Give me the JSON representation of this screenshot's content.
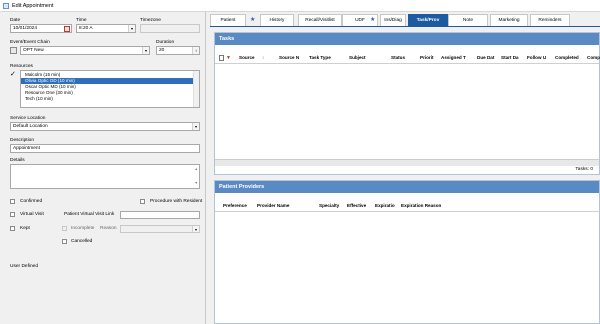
{
  "window": {
    "title": "Edit Appointment"
  },
  "form": {
    "date_label": "Date",
    "date_value": "10/01/2024",
    "time_label": "Time",
    "time_value": "8:20 A",
    "timezone_label": "Timezone",
    "timezone_value": "",
    "event_chain_label": "Event/Event Chain",
    "event_chain_value": "OPT New",
    "duration_label": "Duration",
    "duration_value": "20",
    "resources_label": "Resources",
    "resources": [
      {
        "label": "Malcolm (15 min)",
        "selected": false
      },
      {
        "label": "Olivia Optic OD (10 min)",
        "selected": true
      },
      {
        "label": "Oscar Optic MD (10 min)",
        "selected": false
      },
      {
        "label": "Resource One (30 min)",
        "selected": false
      },
      {
        "label": "Tech (10 min)",
        "selected": false
      }
    ],
    "service_location_label": "Service Location",
    "service_location_value": "Default Location",
    "description_label": "Description",
    "description_value": "Appointment",
    "details_label": "Details",
    "details_value": "",
    "confirmed_label": "Confirmed",
    "procedure_label": "Procedure with Resident",
    "virtual_visit_label": "Virtual Visit",
    "virtual_link_label": "Patient Virtual Visit Link",
    "virtual_link_value": "",
    "kept_label": "Kept",
    "incomplete_label": "Incomplete",
    "reason_label": "Reason",
    "reason_value": "",
    "cancelled_label": "Cancelled",
    "user_defined_label": "User Defined"
  },
  "tabs": [
    {
      "label": "Patient",
      "active": false,
      "pinned": false
    },
    {
      "label": "History",
      "active": false,
      "pinned": true
    },
    {
      "label": "Recall/Visitlist",
      "active": false,
      "pinned": false
    },
    {
      "label": "UDF",
      "active": false,
      "pinned": false
    },
    {
      "label": "Ins/Diag",
      "active": false,
      "pinned": true
    },
    {
      "label": "Task/Prov",
      "active": true,
      "pinned": false
    },
    {
      "label": "Note",
      "active": false,
      "pinned": false
    },
    {
      "label": "Marketing",
      "active": false,
      "pinned": false
    },
    {
      "label": "Reminders",
      "active": false,
      "pinned": false
    }
  ],
  "tasks": {
    "title": "Tasks",
    "columns": [
      "Source",
      "Source N",
      "Task Type",
      "Subject",
      "Status",
      "Priorit",
      "Assigned T",
      "Due Dat",
      "Start Da",
      "Follow U",
      "Completed",
      "Comp"
    ],
    "rows": [],
    "count_text": "Tasks: 0"
  },
  "providers": {
    "title": "Patient Providers",
    "columns": [
      "Preference",
      "Provider Name",
      "Specialty",
      "Effective",
      "Expiratio",
      "Expiration Reason"
    ],
    "rows": []
  },
  "colors": {
    "accent": "#1e5aa0",
    "panel_header": "#5a8ac4",
    "selection": "#2f6fba"
  }
}
